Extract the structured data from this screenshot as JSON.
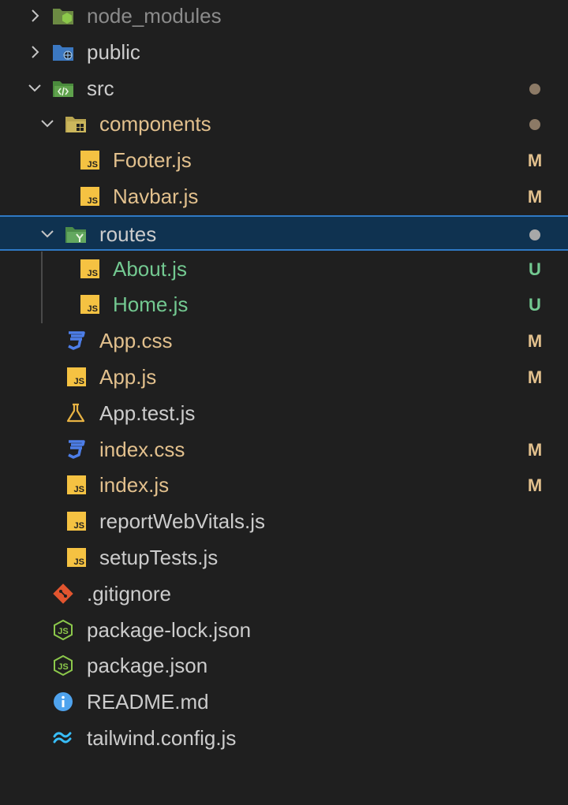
{
  "colors": {
    "background": "#1f1f1f",
    "selected_bg": "#0f3250",
    "selected_border": "#2f79c4",
    "default_text": "#cccccc",
    "modified": "#e2c08d",
    "untracked": "#73c991",
    "dimmed": "#8b8b8b",
    "status_dot": "#8c7a66",
    "status_dot_selected": "#a8a8a8",
    "js_icon": "#f5c242",
    "css_icon": "#4d7ee8",
    "git_icon": "#e2552f",
    "node_icon": "#8cc84b",
    "info_icon": "#4fa3ee",
    "tailwind_icon": "#38bdf8",
    "test_icon": "#e8b343"
  },
  "explorer": {
    "rows": [
      {
        "name": "node_modules",
        "kind": "folder",
        "expanded": false,
        "icon": "node-folder-icon",
        "status": "",
        "dot": false,
        "color": "dimmed"
      },
      {
        "name": "public",
        "kind": "folder",
        "expanded": false,
        "icon": "public-folder-icon",
        "status": "",
        "dot": false,
        "color": "default"
      },
      {
        "name": "src",
        "kind": "folder",
        "expanded": true,
        "icon": "src-folder-icon",
        "status": "",
        "dot": true,
        "color": "default"
      },
      {
        "name": "components",
        "kind": "folder",
        "expanded": true,
        "icon": "components-folder-icon",
        "status": "",
        "dot": true,
        "color": "modified"
      },
      {
        "name": "Footer.js",
        "kind": "file",
        "icon": "js-icon",
        "status": "M",
        "dot": false,
        "color": "modified"
      },
      {
        "name": "Navbar.js",
        "kind": "file",
        "icon": "js-icon",
        "status": "M",
        "dot": false,
        "color": "modified"
      },
      {
        "name": "routes",
        "kind": "folder",
        "expanded": true,
        "icon": "routes-folder-icon",
        "status": "",
        "dot": true,
        "color": "default",
        "selected": true
      },
      {
        "name": "About.js",
        "kind": "file",
        "icon": "js-icon",
        "status": "U",
        "dot": false,
        "color": "untracked"
      },
      {
        "name": "Home.js",
        "kind": "file",
        "icon": "js-icon",
        "status": "U",
        "dot": false,
        "color": "untracked"
      },
      {
        "name": "App.css",
        "kind": "file",
        "icon": "css-icon",
        "status": "M",
        "dot": false,
        "color": "modified"
      },
      {
        "name": "App.js",
        "kind": "file",
        "icon": "js-icon",
        "status": "M",
        "dot": false,
        "color": "modified"
      },
      {
        "name": "App.test.js",
        "kind": "file",
        "icon": "test-flask-icon",
        "status": "",
        "dot": false,
        "color": "default"
      },
      {
        "name": "index.css",
        "kind": "file",
        "icon": "css-icon",
        "status": "M",
        "dot": false,
        "color": "modified"
      },
      {
        "name": "index.js",
        "kind": "file",
        "icon": "js-icon",
        "status": "M",
        "dot": false,
        "color": "modified"
      },
      {
        "name": "reportWebVitals.js",
        "kind": "file",
        "icon": "js-icon",
        "status": "",
        "dot": false,
        "color": "default"
      },
      {
        "name": "setupTests.js",
        "kind": "file",
        "icon": "js-icon",
        "status": "",
        "dot": false,
        "color": "default"
      },
      {
        "name": ".gitignore",
        "kind": "file",
        "icon": "git-icon",
        "status": "",
        "dot": false,
        "color": "default"
      },
      {
        "name": "package-lock.json",
        "kind": "file",
        "icon": "node-json-icon",
        "status": "",
        "dot": false,
        "color": "default"
      },
      {
        "name": "package.json",
        "kind": "file",
        "icon": "node-json-icon",
        "status": "",
        "dot": false,
        "color": "default"
      },
      {
        "name": "README.md",
        "kind": "file",
        "icon": "info-icon",
        "status": "",
        "dot": false,
        "color": "default"
      },
      {
        "name": "tailwind.config.js",
        "kind": "file",
        "icon": "tailwind-icon",
        "status": "",
        "dot": false,
        "color": "default"
      }
    ]
  }
}
